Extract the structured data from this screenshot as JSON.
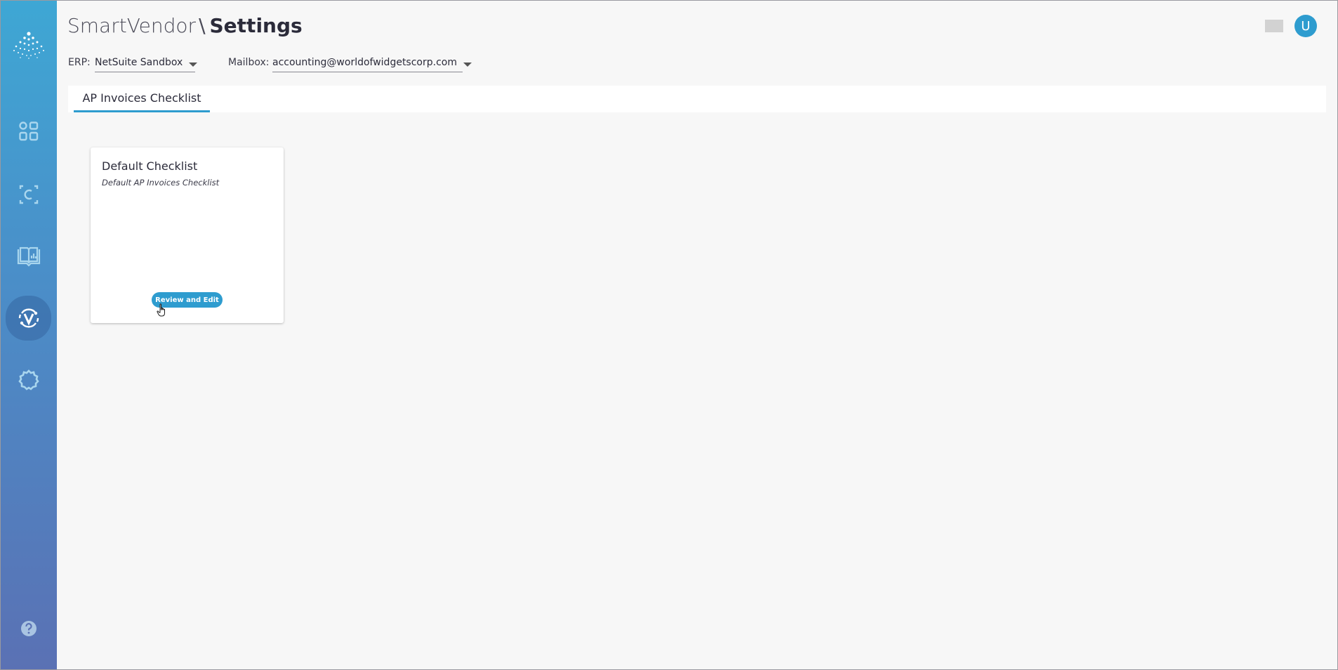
{
  "header": {
    "app_name": "SmartVendor",
    "separator": "\\",
    "page_title": "Settings",
    "avatar_initial": "U"
  },
  "selectors": {
    "erp_label": "ERP:",
    "erp_value": "NetSuite Sandbox",
    "mailbox_label": "Mailbox:",
    "mailbox_value": "accounting@worldofwidgetscorp.com"
  },
  "tabs": [
    {
      "label": "AP Invoices Checklist",
      "active": true
    }
  ],
  "checklist_card": {
    "title": "Default Checklist",
    "subtitle": "Default AP Invoices Checklist",
    "button_label": "Review and Edit"
  },
  "sidebar": {
    "items": [
      {
        "icon": "dashboard-grid-icon",
        "active": false
      },
      {
        "icon": "contract-c-icon",
        "active": false
      },
      {
        "icon": "book-chart-icon",
        "active": false
      },
      {
        "icon": "smartvendor-v-icon",
        "active": true
      },
      {
        "icon": "gear-icon",
        "active": false
      },
      {
        "icon": "help-icon",
        "active": false
      }
    ]
  },
  "colors": {
    "accent": "#2e9ccf",
    "sidebar_top": "#3ea7d4",
    "sidebar_bottom": "#5a71b4",
    "background": "#f7f7f7"
  }
}
